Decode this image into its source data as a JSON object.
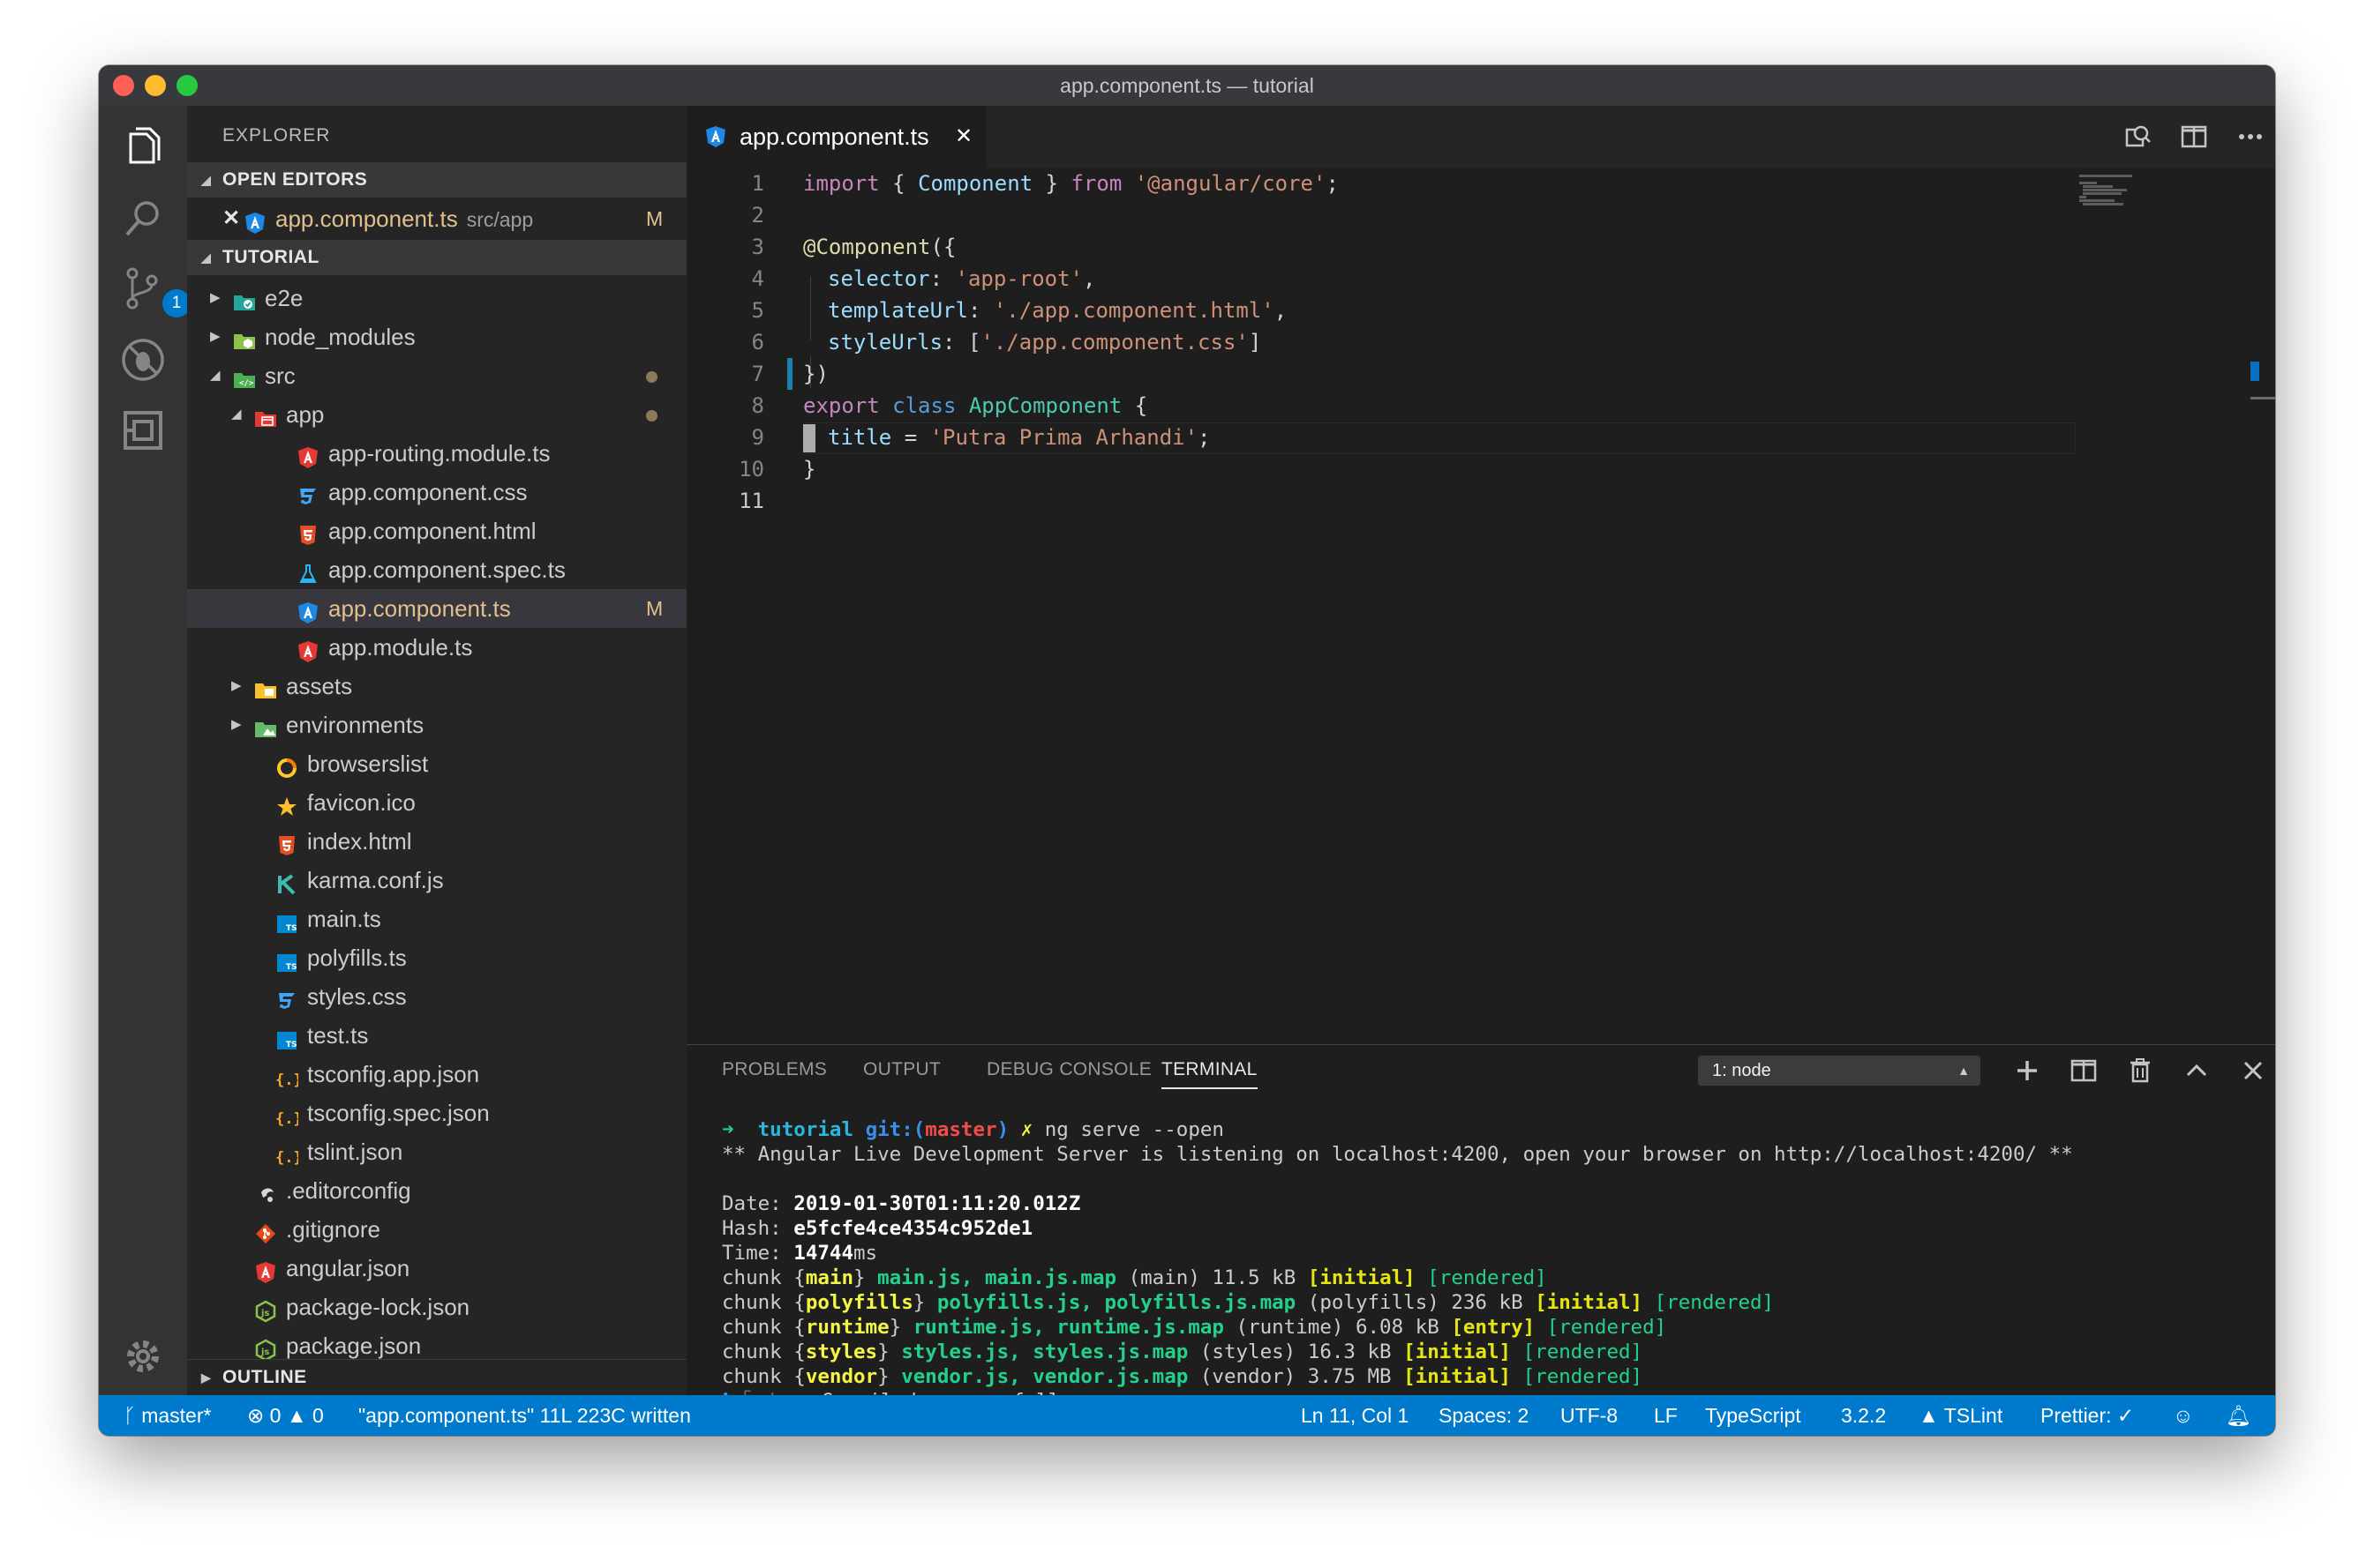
{
  "window": {
    "title": "app.component.ts — tutorial"
  },
  "activity": {
    "scm_badge": "1"
  },
  "sidebar": {
    "title": "EXPLORER",
    "open_editors_label": "OPEN EDITORS",
    "open_editor": {
      "name": "app.component.ts",
      "path": "src/app",
      "status": "M"
    },
    "project_label": "TUTORIAL",
    "outline_label": "OUTLINE",
    "tree": [
      {
        "name": "e2e",
        "type": "folder",
        "icon": "e2e-folder-icon"
      },
      {
        "name": "node_modules",
        "type": "folder",
        "icon": "node-modules-folder-icon"
      },
      {
        "name": "src",
        "type": "folder-open",
        "icon": "src-folder-icon",
        "status": "dot"
      },
      {
        "name": "app",
        "type": "folder-open",
        "icon": "app-folder-icon",
        "status": "dot"
      },
      {
        "name": "app-routing.module.ts",
        "icon": "angular-icon"
      },
      {
        "name": "app.component.css",
        "icon": "css-icon"
      },
      {
        "name": "app.component.html",
        "icon": "html-icon"
      },
      {
        "name": "app.component.spec.ts",
        "icon": "test-flask-icon"
      },
      {
        "name": "app.component.ts",
        "icon": "angular-component-icon",
        "status": "M",
        "selected": true
      },
      {
        "name": "app.module.ts",
        "icon": "angular-icon"
      },
      {
        "name": "assets",
        "type": "folder",
        "icon": "assets-folder-icon"
      },
      {
        "name": "environments",
        "type": "folder",
        "icon": "environments-folder-icon"
      },
      {
        "name": "browserslist",
        "icon": "browserslist-icon"
      },
      {
        "name": "favicon.ico",
        "icon": "star-icon"
      },
      {
        "name": "index.html",
        "icon": "html-icon"
      },
      {
        "name": "karma.conf.js",
        "icon": "karma-icon"
      },
      {
        "name": "main.ts",
        "icon": "typescript-icon"
      },
      {
        "name": "polyfills.ts",
        "icon": "typescript-icon"
      },
      {
        "name": "styles.css",
        "icon": "css-icon"
      },
      {
        "name": "test.ts",
        "icon": "typescript-icon"
      },
      {
        "name": "tsconfig.app.json",
        "icon": "json-icon"
      },
      {
        "name": "tsconfig.spec.json",
        "icon": "json-icon"
      },
      {
        "name": "tslint.json",
        "icon": "json-icon"
      },
      {
        "name": ".editorconfig",
        "icon": "editorconfig-icon"
      },
      {
        "name": ".gitignore",
        "icon": "git-icon"
      },
      {
        "name": "angular.json",
        "icon": "angular-icon"
      },
      {
        "name": "package-lock.json",
        "icon": "nodejs-icon"
      },
      {
        "name": "package.json",
        "icon": "nodejs-icon"
      }
    ]
  },
  "editor": {
    "tab_label": "app.component.ts",
    "line_numbers": [
      "1",
      "2",
      "3",
      "4",
      "5",
      "6",
      "7",
      "8",
      "9",
      "10",
      "11"
    ],
    "code": {
      "l1_import": "import",
      "l1_open": " { ",
      "l1_component": "Component",
      "l1_close": " } ",
      "l1_from": "from",
      "l1_sp": " ",
      "l1_str": "'@angular/core'",
      "l1_semi": ";",
      "l3_decorator": "@Component",
      "l3_paren": "({",
      "l4_key": "selector",
      "l4_colon": ": ",
      "l4_val": "'app-root'",
      "l4_comma": ",",
      "l5_key": "templateUrl",
      "l5_colon": ": ",
      "l5_val": "'./app.component.html'",
      "l5_comma": ",",
      "l6_key": "styleUrls",
      "l6_colon": ": [",
      "l6_val": "'./app.component.css'",
      "l6_end": "]",
      "l7": "})",
      "l8_export": "export",
      "l8_sp": " ",
      "l8_class": "class",
      "l8_sp2": " ",
      "l8_name": "AppComponent",
      "l8_brace": " {",
      "l9_key": "title",
      "l9_eq": " = ",
      "l9_val": "'Putra Prima Arhandi'",
      "l9_semi": ";",
      "l10": "}"
    }
  },
  "panel": {
    "tabs": [
      "PROBLEMS",
      "OUTPUT",
      "DEBUG CONSOLE",
      "TERMINAL"
    ],
    "active_tab": "TERMINAL",
    "terminal_select": "1: node",
    "terminal": {
      "prompt_arrow": "➜",
      "prompt_dir": "tutorial",
      "prompt_git": "git:(",
      "prompt_branch": "master",
      "prompt_git_close": ")",
      "prompt_x": "✗",
      "command": "ng serve --open",
      "line2": "** Angular Live Development Server is listening on localhost:4200, open your browser on http://localhost:4200/ **",
      "date_label": "Date: ",
      "date_value": "2019-01-30T01:11:20.012Z",
      "hash_label": "Hash: ",
      "hash_value": "e5fcfe4ce4354c952de1",
      "time_label": "Time: ",
      "time_value": "14744",
      "time_unit": "ms",
      "chunks": [
        {
          "name": "main",
          "files": "main.js, main.js.map",
          "label": "(main)",
          "size": "11.5 kB",
          "flag": "[initial]",
          "state": "[rendered]"
        },
        {
          "name": "polyfills",
          "files": "polyfills.js, polyfills.js.map",
          "label": "(polyfills)",
          "size": "236 kB",
          "flag": "[initial]",
          "state": "[rendered]"
        },
        {
          "name": "runtime",
          "files": "runtime.js, runtime.js.map",
          "label": "(runtime)",
          "size": "6.08 kB",
          "flag": "[entry]",
          "state": "[rendered]"
        },
        {
          "name": "styles",
          "files": "styles.js, styles.js.map",
          "label": "(styles)",
          "size": "16.3 kB",
          "flag": "[initial]",
          "state": "[rendered]"
        },
        {
          "name": "vendor",
          "files": "vendor.js, vendor.js.map",
          "label": "(vendor)",
          "size": "3.75 MB",
          "flag": "[initial]",
          "state": "[rendered]"
        }
      ],
      "chunk_word": "chunk",
      "wdm_info": "ℹ",
      "wdm_tag": "｢wdm｣",
      "wdm_msg": ": Compiled successfully."
    }
  },
  "statusbar": {
    "branch": "master*",
    "errors": "0",
    "warnings": "0",
    "message": "\"app.component.ts\" 11L 223C written",
    "position": "Ln 11, Col 1",
    "spaces": "Spaces: 2",
    "encoding": "UTF-8",
    "eol": "LF",
    "language": "TypeScript",
    "ts_version": "3.2.2",
    "tslint": "TSLint",
    "prettier": "Prettier: ✓"
  },
  "colors": {
    "accent": "#007acc",
    "modified": "#e2c08d",
    "activity_bar": "#333333",
    "sidebar": "#252526",
    "editor": "#1e1e1e"
  }
}
